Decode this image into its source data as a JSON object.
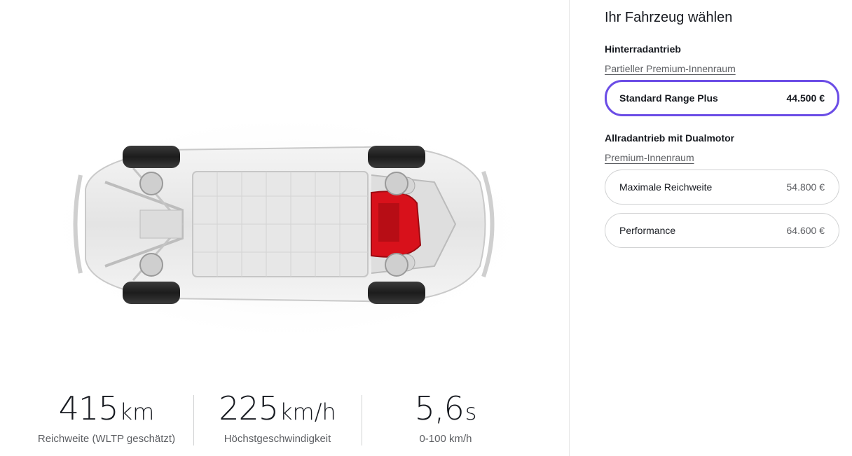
{
  "specs": [
    {
      "value": "415",
      "unit": "km",
      "label": "Reichweite (WLTP geschätzt)"
    },
    {
      "value": "225",
      "unit": "km/h",
      "label": "Höchstgeschwindigkeit"
    },
    {
      "value": "5,6",
      "unit": "s",
      "label": "0-100 km/h"
    }
  ],
  "configurator": {
    "title": "Ihr Fahrzeug wählen",
    "groups": [
      {
        "heading": "Hinterradantrieb",
        "subheading": "Partieller Premium-Innenraum",
        "options": [
          {
            "name": "Standard Range Plus",
            "price": "44.500 €",
            "selected": true
          }
        ]
      },
      {
        "heading": "Allradantrieb mit Dualmotor",
        "subheading": "Premium-Innenraum",
        "options": [
          {
            "name": "Maximale Reichweite",
            "price": "54.800 €",
            "selected": false
          },
          {
            "name": "Performance",
            "price": "64.600 €",
            "selected": false
          }
        ]
      }
    ]
  },
  "colors": {
    "selection_accent": "#6b4de6",
    "motor_red": "#d8111b",
    "text_primary": "#171a20",
    "text_secondary": "#5c5e62"
  }
}
